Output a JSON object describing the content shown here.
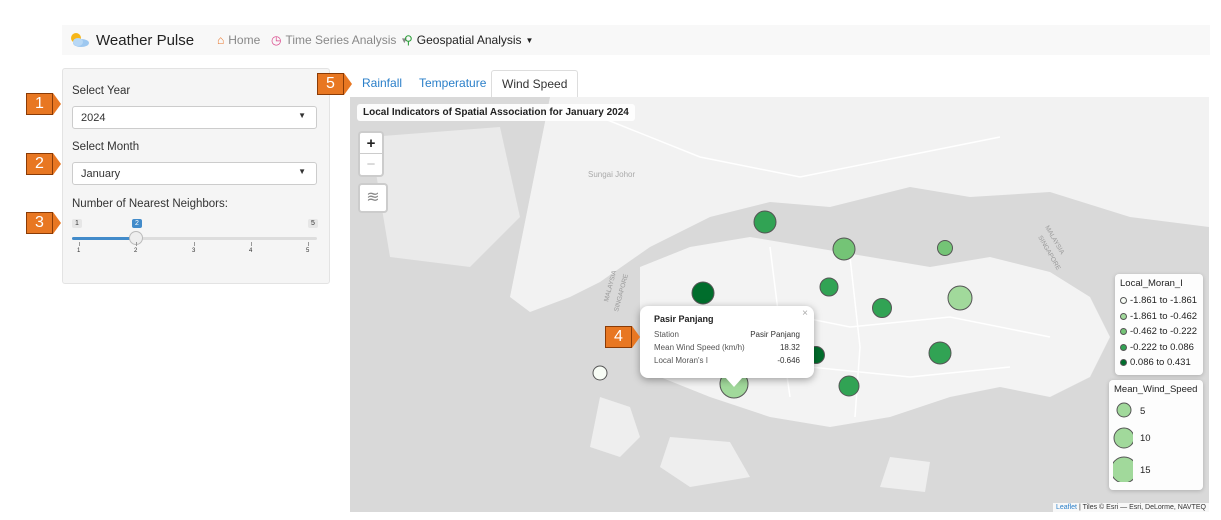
{
  "navbar": {
    "brand": "Weather Pulse",
    "items": [
      {
        "label": "Home"
      },
      {
        "label": "Time Series Analysis"
      },
      {
        "label": "Geospatial Analysis"
      }
    ]
  },
  "sidebar": {
    "year_label": "Select Year",
    "year_value": "2024",
    "month_label": "Select Month",
    "month_value": "January",
    "neighbors_label": "Number of Nearest Neighbors:",
    "slider": {
      "min": "1",
      "max": "5",
      "value": "2",
      "grid": [
        "1",
        "2",
        "3",
        "4",
        "5"
      ]
    }
  },
  "badges": [
    "1",
    "2",
    "3",
    "4",
    "5"
  ],
  "tabs": [
    "Rainfall",
    "Temperature",
    "Wind Speed"
  ],
  "map": {
    "title": "Local Indicators of Spatial Association for January 2024",
    "zoom_in": "+",
    "zoom_out": "−",
    "place_labels": [
      "Sungai Johor",
      "MALAYSIA",
      "SINGAPORE",
      "MALAYSIA",
      "SINGAPORE"
    ],
    "popup": {
      "title": "Pasir Panjang",
      "rows": [
        {
          "label": "Station",
          "value": "Pasir Panjang"
        },
        {
          "label": "Mean Wind Speed (km/h)",
          "value": "18.32"
        },
        {
          "label": "Local Moran's I",
          "value": "-0.646"
        }
      ]
    },
    "legend_moran": {
      "title": "Local_Moran_I",
      "items": [
        {
          "label": "-1.861 to -1.861",
          "color": "#f7fcf5"
        },
        {
          "label": "-1.861 to -0.462",
          "color": "#a1d99b"
        },
        {
          "label": "-0.462 to -0.222",
          "color": "#74c476"
        },
        {
          "label": "-0.222 to 0.086",
          "color": "#31a354"
        },
        {
          "label": "0.086 to 0.431",
          "color": "#006d2c"
        }
      ]
    },
    "legend_wind": {
      "title": "Mean_Wind_Speed",
      "items": [
        "5",
        "10",
        "15"
      ]
    },
    "attribution": {
      "leaflet": "Leaflet",
      "tiles": "| Tiles © Esri — Esri, DeLorme, NAVTEQ"
    }
  }
}
